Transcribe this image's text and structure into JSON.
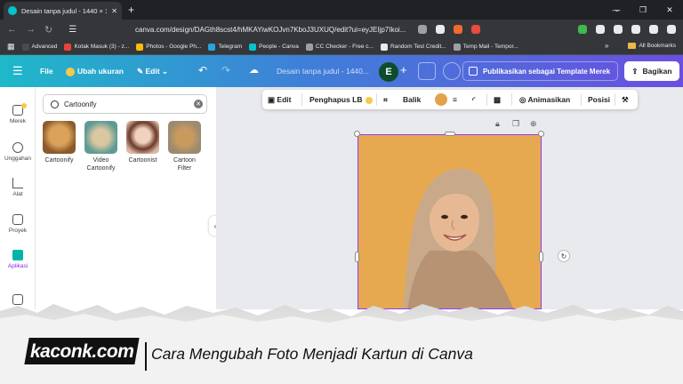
{
  "browser": {
    "tab_title": "Desain tanpa judul - 1440 × 180...",
    "url": "canva.com/design/DAGth8scst4/hMKAYiwKOJvn7KboJ3UXUQ/edit?ui=eyJEIjp7Ikoi...",
    "bookmarks": [
      {
        "label": "Advanced",
        "color": "#4a4b4f"
      },
      {
        "label": "Kotak Masuk (3) - z...",
        "color": "#ea4335"
      },
      {
        "label": "Photos - Google Ph...",
        "color": "#fbbc04"
      },
      {
        "label": "Telegram",
        "color": "#2aa3df"
      },
      {
        "label": "People - Canva",
        "color": "#00c4cc"
      },
      {
        "label": "CC Checker - Free c...",
        "color": "#9aa0a6"
      },
      {
        "label": "Random Test Credit...",
        "color": "#e8eaed"
      },
      {
        "label": "Temp Mail - Tempor...",
        "color": "#9aa0a6"
      }
    ],
    "all_bookmarks": "All Bookmarks"
  },
  "canva": {
    "menu": {
      "file": "File",
      "resize": "Ubah ukuran",
      "edit": "Edit"
    },
    "doc_title": "Desain tanpa judul - 1440...",
    "avatar_letter": "E",
    "publish_template": "Publikasikan sebagai Template Merek",
    "share": "Bagikan"
  },
  "rail": [
    {
      "label": "Merek"
    },
    {
      "label": "Unggahan"
    },
    {
      "label": "Alat"
    },
    {
      "label": "Proyek"
    },
    {
      "label": "Aplikasi"
    }
  ],
  "panel": {
    "search_value": "Cartoonify",
    "apps": [
      {
        "label": "Cartoonify",
        "color": "#b5793a"
      },
      {
        "label": "Video Cartoonify",
        "color": "#6fa8a0"
      },
      {
        "label": "Cartoonist",
        "color": "#c89878"
      },
      {
        "label": "Cartoon Filter",
        "color": "#a77d4e"
      }
    ]
  },
  "context_toolbar": {
    "edit": "Edit",
    "bg_remover": "Penghapus LB",
    "flip": "Balik",
    "animate": "Animasikan",
    "position": "Posisi",
    "fill_color": "#e2a14a"
  },
  "banner": {
    "brand": "kaconk.com",
    "headline": "Cara Mengubah Foto Menjadi Kartun di Canva"
  }
}
